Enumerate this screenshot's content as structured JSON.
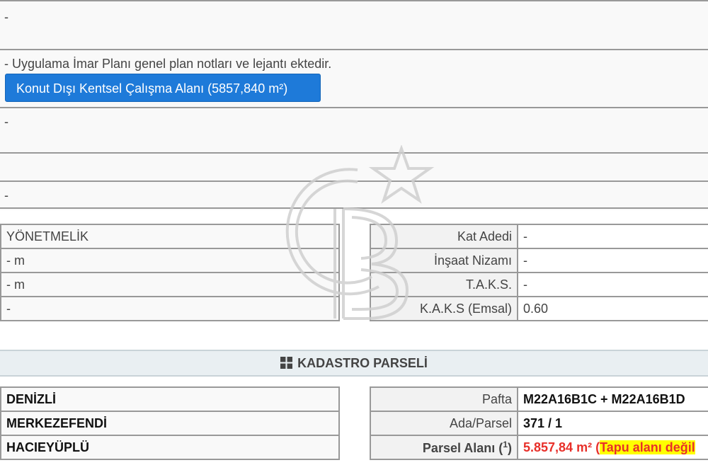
{
  "zoning": {
    "row1": "-",
    "note": "- Uygulama İmar Planı genel plan notları ve lejantı ektedir.",
    "area_button": "Konut Dışı Kentsel Çalışma Alanı (5857,840 m²)",
    "row3": "-",
    "row4": "",
    "row5": "-"
  },
  "regulation": {
    "left": [
      "YÖNETMELİK",
      "- m",
      "- m",
      "-"
    ],
    "right": [
      {
        "label": "Kat Adedi",
        "value": "-"
      },
      {
        "label": "İnşaat Nizamı",
        "value": "-"
      },
      {
        "label": "T.A.K.S.",
        "value": "-"
      },
      {
        "label": "K.A.K.S (Emsal)",
        "value": "0.60"
      }
    ]
  },
  "cadastre": {
    "title": "KADASTRO PARSELİ",
    "left": [
      "DENİZLİ",
      "MERKEZEFENDİ",
      "HACIEYÜPLÜ"
    ],
    "pafta_label": "Pafta",
    "pafta_value": "M22A16B1C + M22A16B1D",
    "ada_label": "Ada/Parsel",
    "ada_value": "371 / 1",
    "parsel_label": "Parsel Alanı (",
    "parsel_sup": "1",
    "parsel_label_end": ")",
    "parsel_value": "5.857,84 m² (",
    "parsel_note": "Tapu alanı değil"
  },
  "colors": {
    "button": "#1e7ad9",
    "alert": "#e8302a",
    "highlight": "#ffff00"
  }
}
